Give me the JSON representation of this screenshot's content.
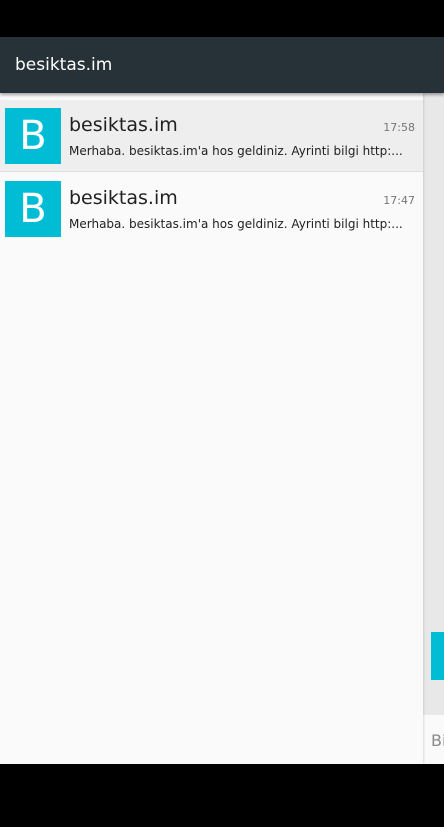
{
  "app_bar": {
    "title": "besiktas.im"
  },
  "messages": [
    {
      "avatar_letter": "B",
      "sender": "besiktas.im",
      "time": "17:58",
      "preview": "Merhaba. besiktas.im'a hos geldiniz. Ayrinti bilgi http:...",
      "selected": true
    },
    {
      "avatar_letter": "B",
      "sender": "besiktas.im",
      "time": "17:47",
      "preview": "Merhaba. besiktas.im'a hos geldiniz. Ayrinti bilgi http:...",
      "selected": false
    }
  ],
  "background_screen": {
    "partial_text": "Bi"
  },
  "colors": {
    "app_bar": "#263238",
    "accent": "#00bcd4",
    "list_background": "#fafafa",
    "selected_item": "#eeeeee"
  }
}
